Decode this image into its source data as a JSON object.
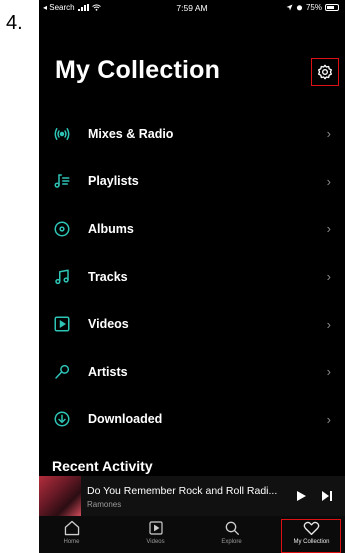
{
  "step_label": "4.",
  "status_bar": {
    "back_app": "◂ Search",
    "time": "7:59 AM",
    "battery": "75%"
  },
  "page_title": "My Collection",
  "menu": [
    {
      "label": "Mixes & Radio",
      "icon": "radio-icon"
    },
    {
      "label": "Playlists",
      "icon": "playlist-icon"
    },
    {
      "label": "Albums",
      "icon": "album-icon"
    },
    {
      "label": "Tracks",
      "icon": "music-note-icon"
    },
    {
      "label": "Videos",
      "icon": "video-icon"
    },
    {
      "label": "Artists",
      "icon": "microphone-icon"
    },
    {
      "label": "Downloaded",
      "icon": "download-icon"
    }
  ],
  "recent_activity": {
    "title": "Recent Activity"
  },
  "now_playing": {
    "title": "Do You Remember Rock and Roll Radi...",
    "artist": "Ramones"
  },
  "tabs": [
    {
      "label": "Home",
      "icon": "home-icon"
    },
    {
      "label": "Videos",
      "icon": "video-icon"
    },
    {
      "label": "Explore",
      "icon": "search-icon"
    },
    {
      "label": "My Collection",
      "icon": "heart-icon",
      "active": true
    }
  ],
  "colors": {
    "accent": "#2ec4b6",
    "highlight_box": "#dd1111",
    "background": "#000000"
  }
}
